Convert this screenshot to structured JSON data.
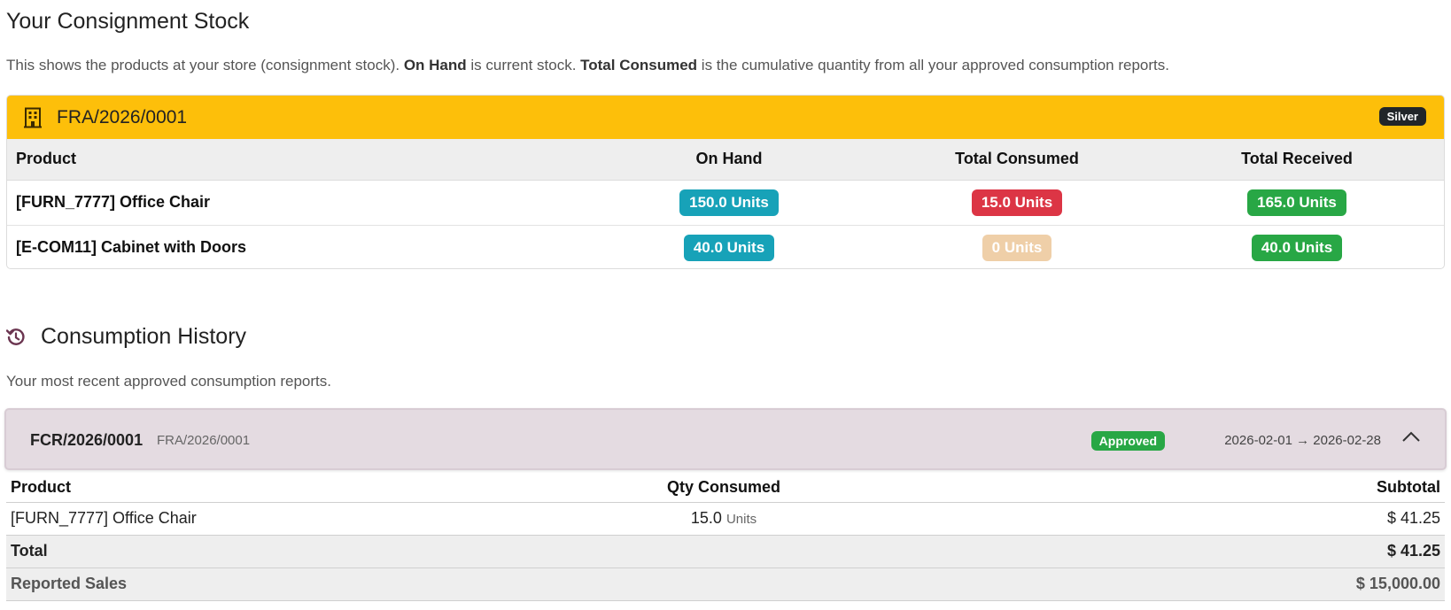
{
  "stock": {
    "title": "Your Consignment Stock",
    "intro_pre": "This shows the products at your store (consignment stock). ",
    "intro_b1": "On Hand",
    "intro_mid": " is current stock. ",
    "intro_b2": "Total Consumed",
    "intro_post": " is the cumulative quantity from all your approved consumption reports.",
    "agreement_ref": "FRA/2026/0001",
    "tier_badge": "Silver",
    "header_color": "#fdbf0a",
    "columns": [
      "Product",
      "On Hand",
      "Total Consumed",
      "Total Received"
    ],
    "rows": [
      {
        "product": "[FURN_7777] Office Chair",
        "on_hand": "150.0 Units",
        "consumed": "15.0 Units",
        "received": "165.0 Units"
      },
      {
        "product": "[E-COM11] Cabinet with Doors",
        "on_hand": "40.0 Units",
        "consumed": "0 Units",
        "received": "40.0 Units"
      }
    ]
  },
  "history": {
    "title": "Consumption History",
    "subtitle": "Your most recent approved consumption reports.",
    "report": {
      "number": "FCR/2026/0001",
      "agreement_ref": "FRA/2026/0001",
      "status": "Approved",
      "period": "2026-02-01 → 2026-02-28"
    },
    "columns": [
      "Product",
      "Qty Consumed",
      "Subtotal"
    ],
    "lines": [
      {
        "product": "[FURN_7777] Office Chair",
        "qty": "15.0",
        "uom": "Units",
        "subtotal": "$ 41.25"
      }
    ],
    "total_label": "Total",
    "total_value": "$ 41.25",
    "sales_label": "Reported Sales",
    "sales_value": "$ 15,000.00"
  },
  "icons": {
    "building": "building-icon",
    "history": "history-icon",
    "collapse": "chevron-up-icon"
  },
  "colors": {
    "info": "#17a2b8",
    "danger": "#dc3545",
    "success": "#28a745",
    "muted": "#efcfa8"
  }
}
